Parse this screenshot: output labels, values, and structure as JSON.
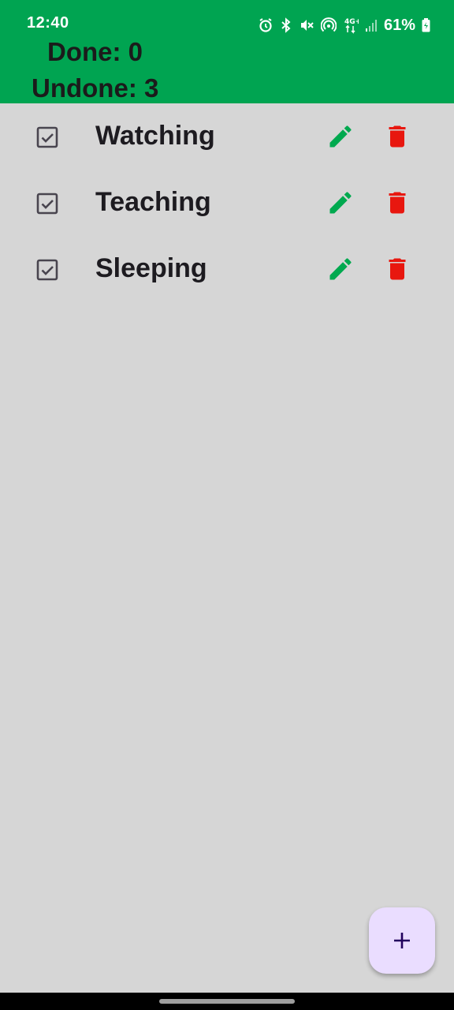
{
  "status_bar": {
    "time": "12:40",
    "battery": "61%",
    "icons": [
      "alarm-icon",
      "bluetooth-icon",
      "mute-icon",
      "hotspot-icon",
      "4g-data-icon",
      "signal-icon",
      "battery-icon"
    ]
  },
  "header": {
    "done_text": "Done: 0",
    "undone_text": "Undone: 3",
    "color": "#00a451"
  },
  "tasks": [
    {
      "label": "Watching",
      "checked": true
    },
    {
      "label": "Teaching",
      "checked": true
    },
    {
      "label": "Sleeping",
      "checked": true
    }
  ],
  "colors": {
    "edit": "#00a94f",
    "delete": "#e8170f",
    "fab": "#eaddff",
    "background": "#d6d6d6"
  },
  "fab": {
    "icon": "plus-icon"
  }
}
